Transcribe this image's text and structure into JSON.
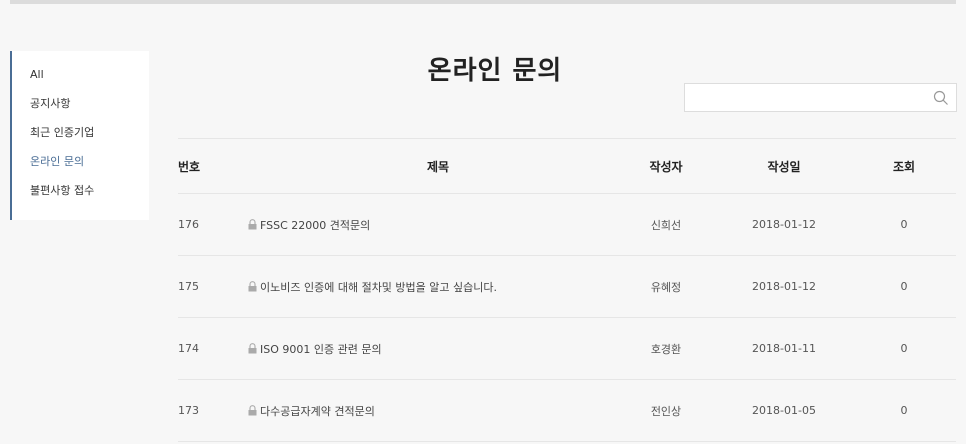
{
  "sidebar": {
    "items": [
      {
        "label": "All",
        "active": false
      },
      {
        "label": "공지사항",
        "active": false
      },
      {
        "label": "최근 인증기업",
        "active": false
      },
      {
        "label": "온라인 문의",
        "active": true
      },
      {
        "label": "불편사항 접수",
        "active": false
      }
    ]
  },
  "page": {
    "title": "온라인 문의"
  },
  "search": {
    "placeholder": "",
    "value": "",
    "icon": "search-icon"
  },
  "table": {
    "headers": {
      "no": "번호",
      "title": "제목",
      "author": "작성자",
      "date": "작성일",
      "views": "조회"
    },
    "rows": [
      {
        "no": "176",
        "title": "FSSC 22000 견적문의",
        "author": "신희선",
        "date": "2018-01-12",
        "views": "0",
        "locked": true
      },
      {
        "no": "175",
        "title": "이노비즈 인증에 대해 절차및 방법을 알고 싶습니다.",
        "author": "유혜정",
        "date": "2018-01-12",
        "views": "0",
        "locked": true
      },
      {
        "no": "174",
        "title": "ISO 9001 인증 관련 문의",
        "author": "호경환",
        "date": "2018-01-11",
        "views": "0",
        "locked": true
      },
      {
        "no": "173",
        "title": "다수공급자계약 견적문의",
        "author": "전인상",
        "date": "2018-01-05",
        "views": "0",
        "locked": true
      }
    ]
  },
  "colors": {
    "accent": "#4a6d95",
    "background": "#f7f7f7"
  }
}
